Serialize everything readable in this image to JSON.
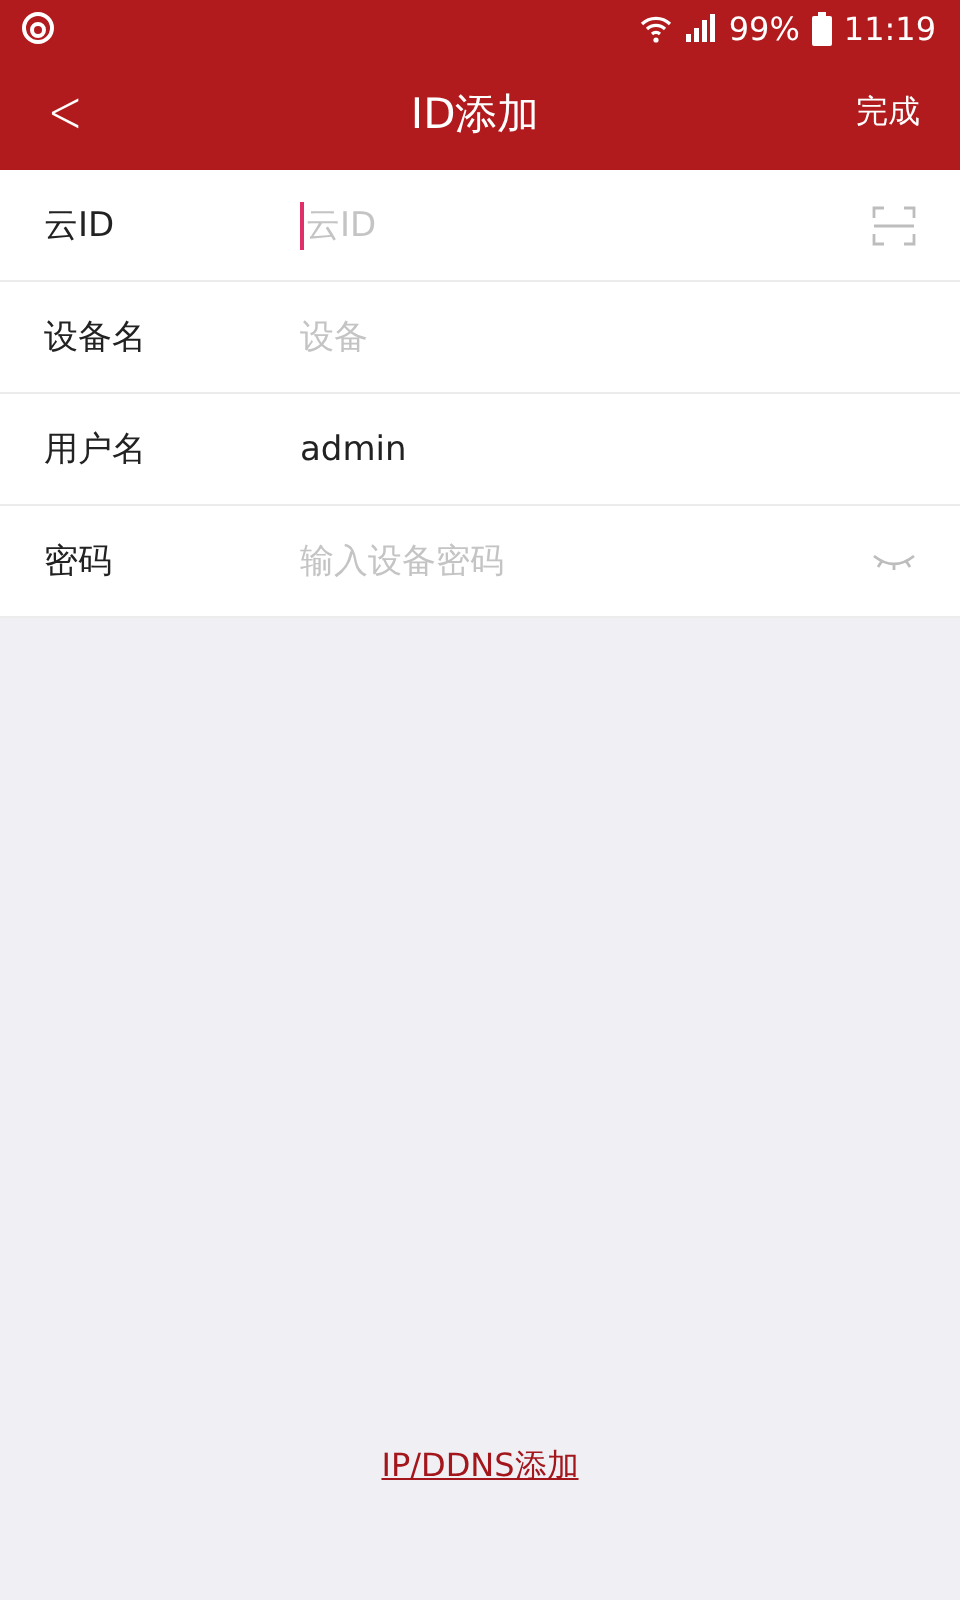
{
  "status_bar": {
    "battery": "99%",
    "time": "11:19"
  },
  "header": {
    "back": "<",
    "title": "ID添加",
    "action": "完成"
  },
  "fields": [
    {
      "label": "云ID",
      "placeholder": "云ID",
      "focused": true,
      "kind": "scan"
    },
    {
      "label": "设备名",
      "placeholder": "设备",
      "focused": false,
      "kind": "plain"
    },
    {
      "label": "用户名",
      "value": "admin",
      "focused": false,
      "kind": "plain"
    },
    {
      "label": "密码",
      "placeholder": "输入设备密码",
      "focused": false,
      "kind": "password"
    }
  ],
  "footer_link": "IP/DDNS添加"
}
